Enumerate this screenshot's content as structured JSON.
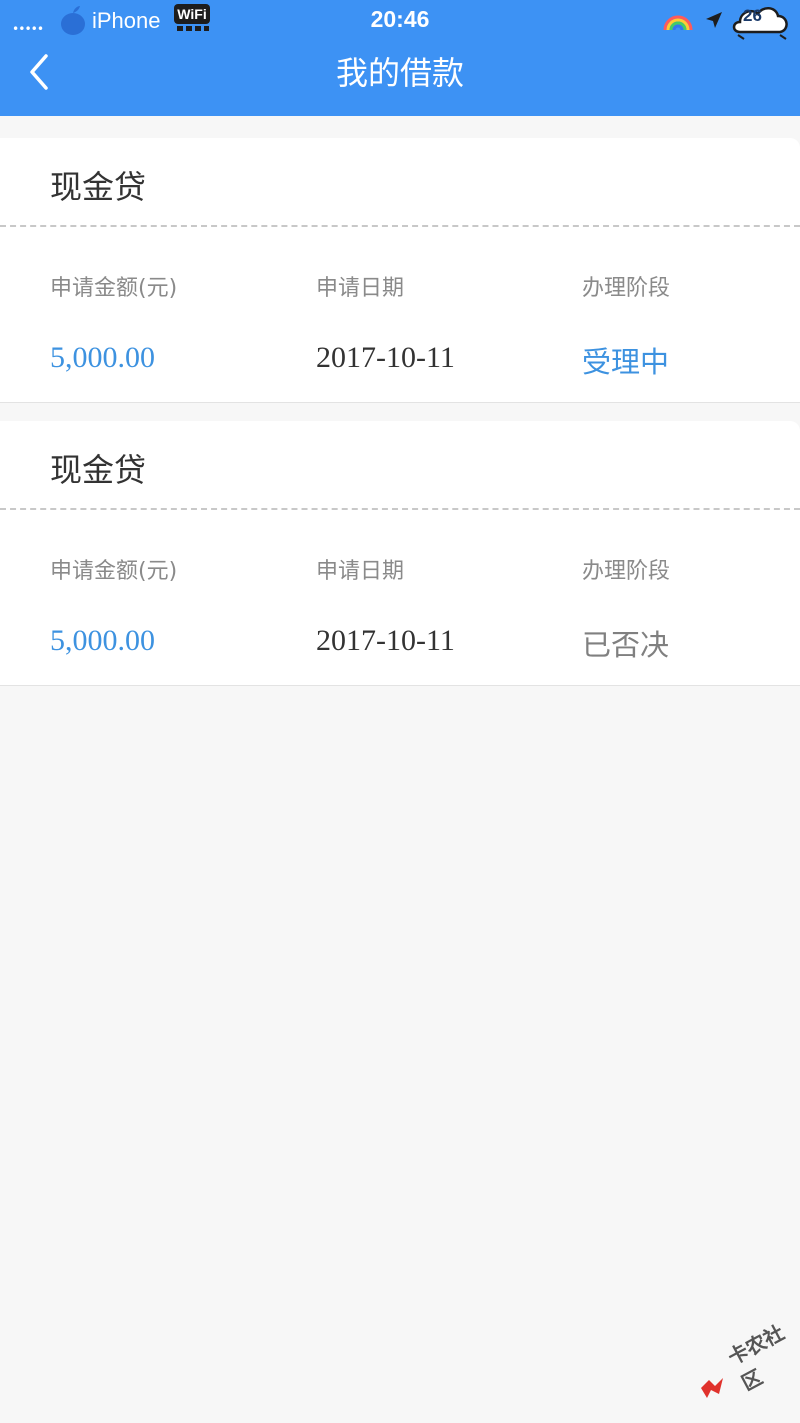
{
  "status_bar": {
    "carrier_dots": "•••••",
    "carrier": "iPhone",
    "wifi_text": "WiFi",
    "time": "20:46",
    "battery": "26",
    "icons": {
      "apple": "apple-logo-icon",
      "rainbow": "rainbow-icon",
      "location": "location-arrow-icon",
      "battery": "cloud-battery-icon"
    }
  },
  "nav": {
    "back_icon": "chevron-left-icon",
    "title": "我的借款"
  },
  "colors": {
    "primary": "#3d92f4",
    "value_blue": "#3d92e0",
    "label_gray": "#8a8a8a",
    "background": "#f7f7f7"
  },
  "loans": [
    {
      "title": "现金贷",
      "amount_label": "申请金额(元)",
      "amount": "5,000.00",
      "date_label": "申请日期",
      "date": "2017-10-11",
      "stage_label": "办理阶段",
      "stage": "受理中"
    },
    {
      "title": "现金贷",
      "amount_label": "申请金额(元)",
      "amount": "5,000.00",
      "date_label": "申请日期",
      "date": "2017-10-11",
      "stage_label": "办理阶段",
      "stage": "已否决"
    }
  ],
  "watermark": {
    "text": "卡农社区"
  }
}
